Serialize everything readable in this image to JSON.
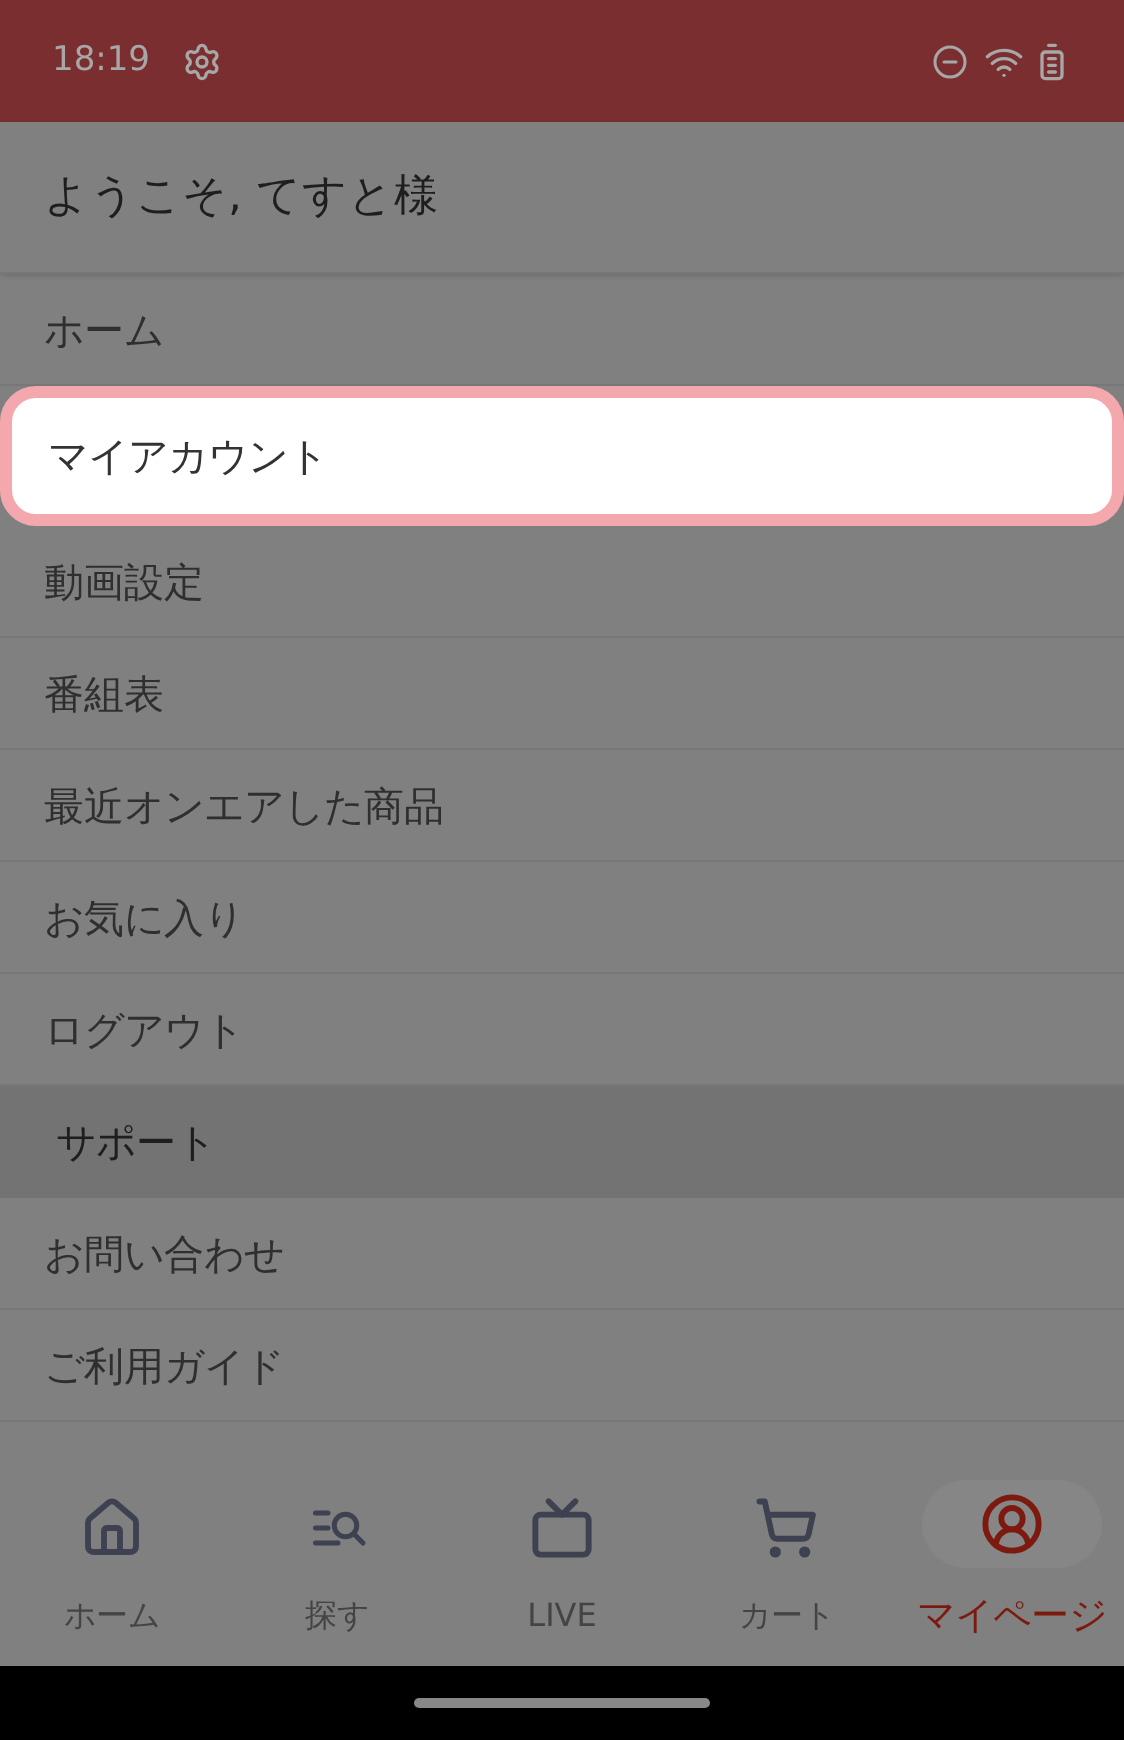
{
  "status_bar": {
    "time": "18:19"
  },
  "header": {
    "title": "ようこそ, てすと様"
  },
  "menu": [
    {
      "kind": "item",
      "label": "ホーム",
      "selected": false
    },
    {
      "kind": "item",
      "label": "マイアカウント",
      "selected": true
    },
    {
      "kind": "item",
      "label": "動画設定",
      "selected": false
    },
    {
      "kind": "item",
      "label": "番組表",
      "selected": false
    },
    {
      "kind": "item",
      "label": "最近オンエアした商品",
      "selected": false
    },
    {
      "kind": "item",
      "label": "お気に入り",
      "selected": false
    },
    {
      "kind": "item",
      "label": "ログアウト",
      "selected": false
    },
    {
      "kind": "section",
      "label": "サポート"
    },
    {
      "kind": "item",
      "label": "お問い合わせ",
      "selected": false
    },
    {
      "kind": "item",
      "label": "ご利用ガイド",
      "selected": false
    }
  ],
  "bottom_nav": [
    {
      "kind": "home",
      "label": "ホーム",
      "selected": false
    },
    {
      "kind": "search",
      "label": "探す",
      "selected": false
    },
    {
      "kind": "tv",
      "label": "LIVE",
      "selected": false
    },
    {
      "kind": "cart",
      "label": "カート",
      "selected": false
    },
    {
      "kind": "account",
      "label": "マイページ",
      "selected": true
    }
  ]
}
